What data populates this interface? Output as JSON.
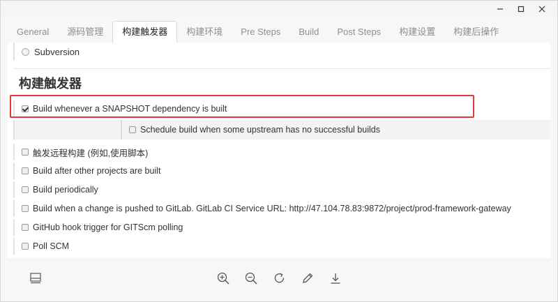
{
  "window": {
    "controls": [
      "minimize",
      "maximize",
      "close"
    ]
  },
  "tabs": [
    {
      "label": "General"
    },
    {
      "label": "源码管理"
    },
    {
      "label": "构建触发器",
      "active": true
    },
    {
      "label": "构建环境"
    },
    {
      "label": "Pre Steps"
    },
    {
      "label": "Build"
    },
    {
      "label": "Post Steps"
    },
    {
      "label": "构建设置"
    },
    {
      "label": "构建后操作"
    }
  ],
  "scm": {
    "subversion_label": "Subversion"
  },
  "section": {
    "title": "构建触发器"
  },
  "options": {
    "snapshot": {
      "label": "Build whenever a SNAPSHOT dependency is built",
      "checked": true
    },
    "schedule_upstream": {
      "label": "Schedule build when some upstream has no successful builds",
      "checked": false
    },
    "remote_trigger": {
      "label": "触发远程构建 (例如,使用脚本)",
      "checked": false
    },
    "after_other": {
      "label": "Build after other projects are built",
      "checked": false
    },
    "periodically": {
      "label": "Build periodically",
      "checked": false
    },
    "gitlab": {
      "label": "Build when a change is pushed to GitLab. GitLab CI Service URL: http://47.104.78.83:9872/project/prod-framework-gateway",
      "checked": false
    },
    "github_hook": {
      "label": "GitHub hook trigger for GITScm polling",
      "checked": false
    },
    "poll_scm": {
      "label": "Poll SCM",
      "checked": false
    }
  },
  "toolbar": {
    "icons": [
      "layout-icon",
      "zoom-in-icon",
      "zoom-out-icon",
      "rotate-icon",
      "edit-icon",
      "download-icon"
    ]
  },
  "colors": {
    "highlight": "#e53935"
  }
}
